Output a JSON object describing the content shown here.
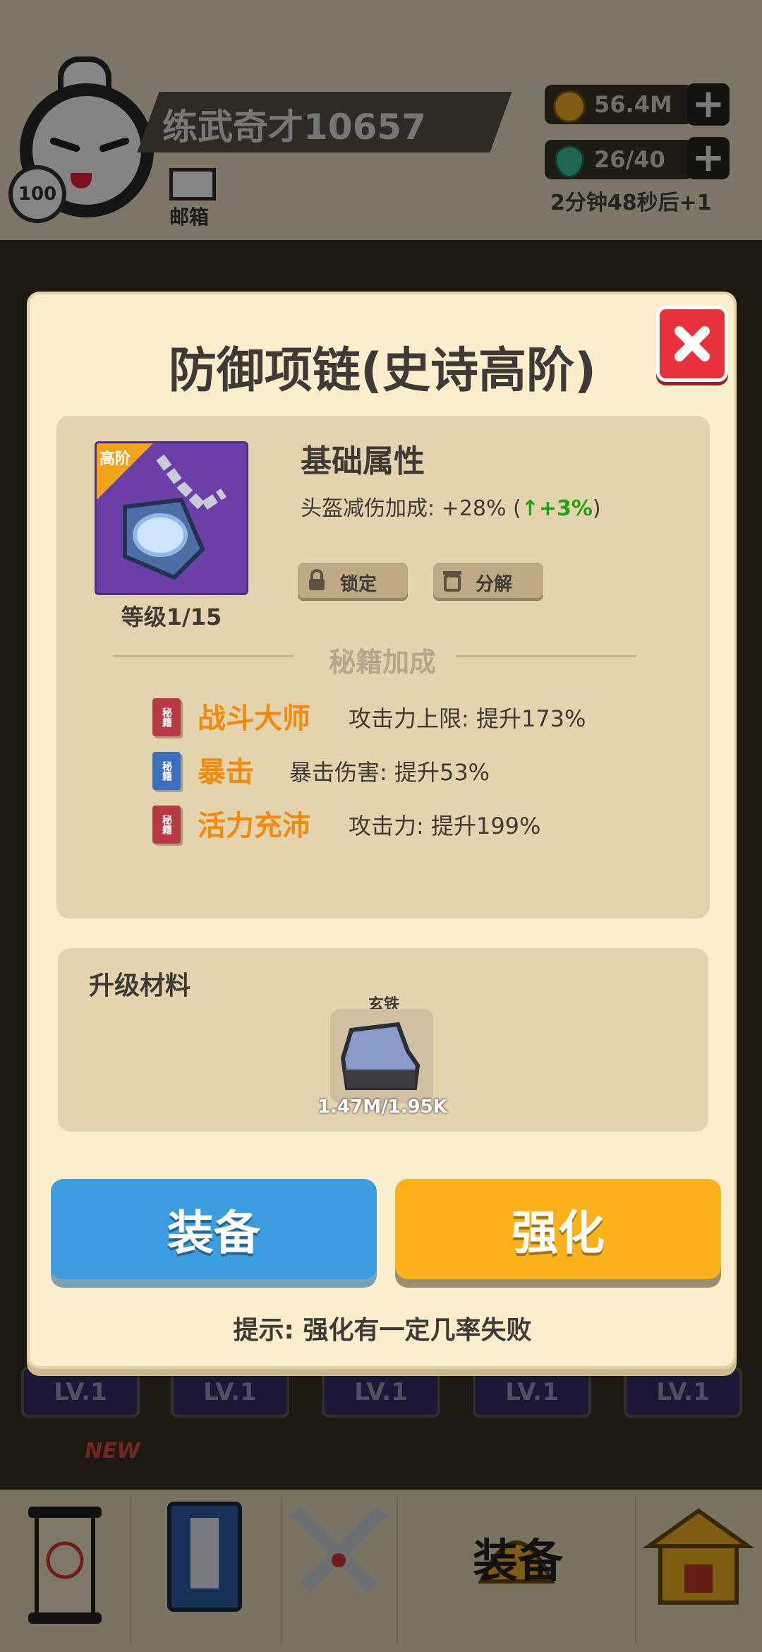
{
  "background": {
    "player_name": "练武奇才10657",
    "player_level": "100",
    "mail_label": "邮箱",
    "coins": "56.4M",
    "energy": "26/40",
    "energy_timer": "2分钟48秒后+1",
    "card_levels": [
      "LV.1",
      "LV.1",
      "LV.1",
      "LV.1",
      "LV.1"
    ],
    "new_tag": "NEW",
    "nav": {
      "active_label": "装备",
      "tab_icons": [
        "scroll-icon",
        "book-icon",
        "swords-icon",
        "helmet-icon",
        "building-icon"
      ]
    }
  },
  "modal": {
    "title": "防御项链(史诗高阶)",
    "item": {
      "rarity_tag": "高阶",
      "level": "等级1/15",
      "icon": "necklace-icon"
    },
    "base_attr": {
      "heading": "基础属性",
      "line_prefix": "头盔减伤加成: +28% (",
      "bonus": "↑+3%",
      "line_suffix": ")"
    },
    "lock_label": "锁定",
    "decompose_label": "分解",
    "secret_heading": "秘籍加成",
    "skills": [
      {
        "book": "秘籍",
        "color": "#b83a45",
        "name": "战斗大师",
        "desc": "攻击力上限: 提升173%"
      },
      {
        "book": "秘籍",
        "color": "#3d6fc0",
        "name": "暴击",
        "desc": "暴击伤害: 提升53%"
      },
      {
        "book": "秘籍",
        "color": "#b83a45",
        "name": "活力充沛",
        "desc": "攻击力: 提升199%"
      }
    ],
    "materials": {
      "heading": "升级材料",
      "name": "玄铁",
      "count": "1.47M/1.95K",
      "icon": "iron-ore-icon"
    },
    "equip_label": "装备",
    "enhance_label": "强化",
    "hint": "提示: 强化有一定几率失败"
  },
  "colors": {
    "accent_orange": "#f38a0a",
    "bonus_green": "#22a516",
    "equip_blue": "#3b9de0",
    "enhance_yellow": "#fab11a",
    "close_red": "#e8313b"
  }
}
